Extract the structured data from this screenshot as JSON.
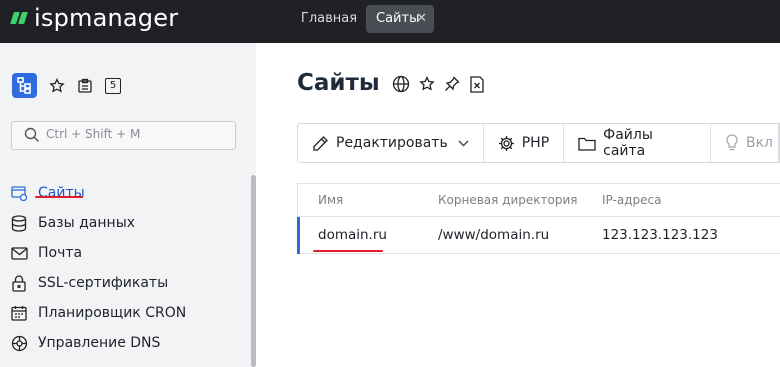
{
  "app": {
    "logo_text": "ispmanager"
  },
  "tabs": [
    {
      "label": "Главная"
    },
    {
      "label": "Сайты",
      "close_icon": "✕"
    }
  ],
  "sidebar": {
    "badge": "5",
    "search_placeholder": "Ctrl + Shift + M",
    "items": [
      {
        "label": "Сайты",
        "icon": "sites-icon",
        "active": true
      },
      {
        "label": "Базы данных",
        "icon": "database-icon"
      },
      {
        "label": "Почта",
        "icon": "mail-icon"
      },
      {
        "label": "SSL-сертификаты",
        "icon": "lock-icon"
      },
      {
        "label": "Планировщик CRON",
        "icon": "calendar-icon"
      },
      {
        "label": "Управление DNS",
        "icon": "dns-icon"
      }
    ]
  },
  "main": {
    "title": "Сайты",
    "toolbar": {
      "edit": "Редактировать",
      "php": "PHP",
      "files": "Файлы сайта",
      "enable": "Вкл"
    },
    "table": {
      "columns": [
        "Имя",
        "Корневая директория",
        "IP-адреса"
      ],
      "rows": [
        {
          "name": "domain.ru",
          "root": "/www/domain.ru",
          "ip": "123.123.123.123"
        }
      ]
    }
  },
  "colors": {
    "accent": "#2f6bdc",
    "highlight": "#e0202b",
    "topbar": "#1f2126",
    "logo": "#3ecf6e"
  }
}
